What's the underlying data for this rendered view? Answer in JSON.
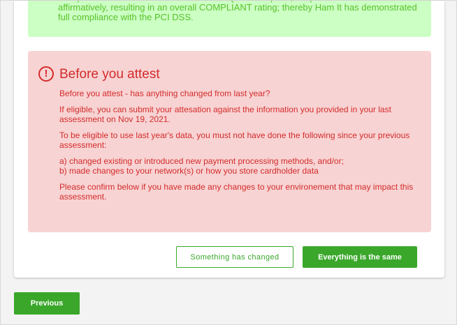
{
  "success_banner": {
    "text": "Compliant. All sections of the PCI DSS SAQ are complete, all questions answered affirmatively, resulting in an overall COMPLIANT rating; thereby Ham It has demonstrated full compliance with the PCI DSS."
  },
  "attest_alert": {
    "icon": "exclamation-circle-icon",
    "title": "Before you attest",
    "paragraphs": {
      "p1": "Before you attest - has anything changed from last year?",
      "p2": "If eligible, you can submit your attesation against the information you provided in your last assessment on Nov 19, 2021.",
      "p3": "To be eligible to use last year's data, you must not have done the following since your previous assessment:",
      "p4a": "a) changed existing or introduced new payment processing methods, and/or;",
      "p4b": "b) made changes to your network(s) or how you store cardholder data",
      "p5": "Please confirm below if you have made any changes to your environement that may impact this assessment."
    }
  },
  "actions": {
    "changed_label": "Something has changed",
    "same_label": "Everything is the same",
    "previous_label": "Previous"
  },
  "colors": {
    "accent_green": "#3aa72b",
    "success_bg": "#ccffc4",
    "success_text": "#57c228",
    "alert_bg": "#f8d3d3",
    "alert_text": "#d32b2b"
  }
}
